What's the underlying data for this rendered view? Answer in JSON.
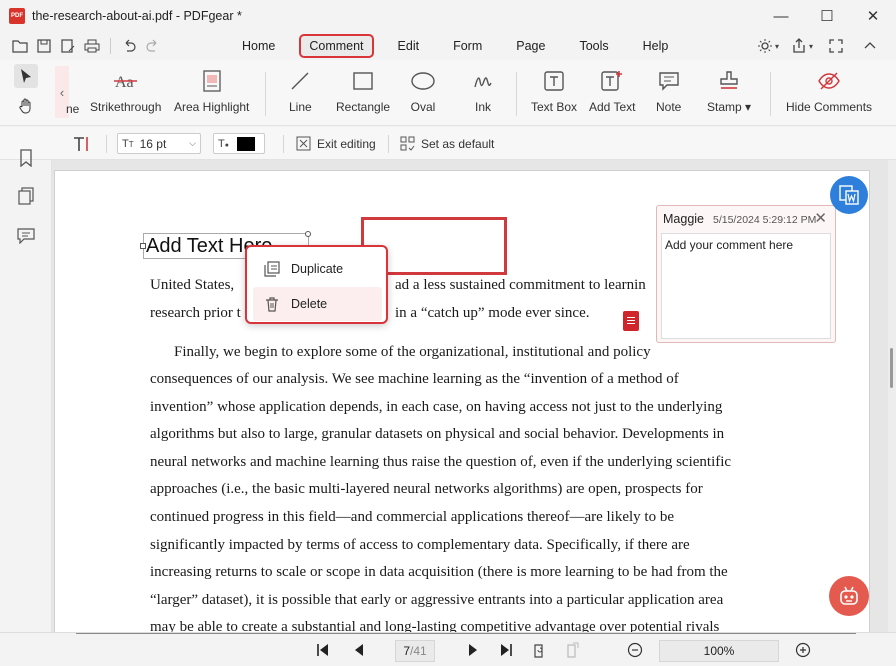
{
  "window": {
    "title": "the-research-about-ai.pdf - PDFgear *",
    "logo_text": "PDF",
    "minimize": "—",
    "maximize": "☐",
    "close": "✕"
  },
  "menu": {
    "items": [
      "Home",
      "Comment",
      "Edit",
      "Form",
      "Page",
      "Tools",
      "Help"
    ],
    "active": "Comment"
  },
  "ribbon": {
    "scroll_label": "ne",
    "tools": [
      {
        "label": "Strikethrough",
        "icon": "strikethrough-icon"
      },
      {
        "label": "Area Highlight",
        "icon": "area-highlight-icon"
      },
      {
        "label": "Line",
        "icon": "line-icon"
      },
      {
        "label": "Rectangle",
        "icon": "rectangle-icon"
      },
      {
        "label": "Oval",
        "icon": "oval-icon"
      },
      {
        "label": "Ink",
        "icon": "ink-icon"
      },
      {
        "label": "Text Box",
        "icon": "text-box-icon"
      },
      {
        "label": "Add Text",
        "icon": "add-text-icon"
      },
      {
        "label": "Note",
        "icon": "note-icon"
      },
      {
        "label": "Stamp ▾",
        "icon": "stamp-icon"
      },
      {
        "label": "Hide Comments",
        "icon": "hide-comments-icon"
      }
    ]
  },
  "propbar": {
    "font_size": "16 pt",
    "exit_editing": "Exit editing",
    "set_default": "Set as default",
    "text_color": "#000000"
  },
  "document": {
    "added_text": "Add Text Here",
    "lines": [
      "United States,",
      "ad a less sustained commitment to learnin",
      "research prior t",
      "in a “catch up” mode ever since.",
      "Finally, we begin to explore some of the organizational, institutional and policy",
      "consequences of our analysis.  We see machine learning as the “invention of a method of",
      "invention” whose application depends, in each case, on having access not just to the underlying",
      "algorithms but also to large, granular datasets on physical and social behavior.  Developments in",
      "neural networks and machine learning thus raise the question of, even if the underlying scientific",
      "approaches (i.e., the basic multi-layered neural networks algorithms) are open, prospects for",
      "continued progress in this field—and commercial applications thereof—are likely to be",
      "significantly impacted by terms of access to complementary data.  Specifically, if there are",
      "increasing returns to scale or scope in data acquisition (there is more learning to be had from the",
      "“larger” dataset), it is possible that early or aggressive entrants into a particular application area",
      "may be able to create a substantial and long-lasting competitive advantage over potential rivals"
    ]
  },
  "context_menu": {
    "items": [
      {
        "label": "Duplicate",
        "icon": "duplicate-icon"
      },
      {
        "label": "Delete",
        "icon": "trash-icon"
      }
    ]
  },
  "comment": {
    "author": "Maggie",
    "date": "5/15/2024 5:29:12 PM",
    "placeholder": "Add your comment here"
  },
  "colors": {
    "accent": "#d9343a",
    "brand_red": "#d9342b",
    "fab_blue": "#2d7fdb",
    "fab_red": "#e45a4f"
  },
  "footer": {
    "page_current": "7",
    "page_total": "/41",
    "zoom": "100%"
  }
}
